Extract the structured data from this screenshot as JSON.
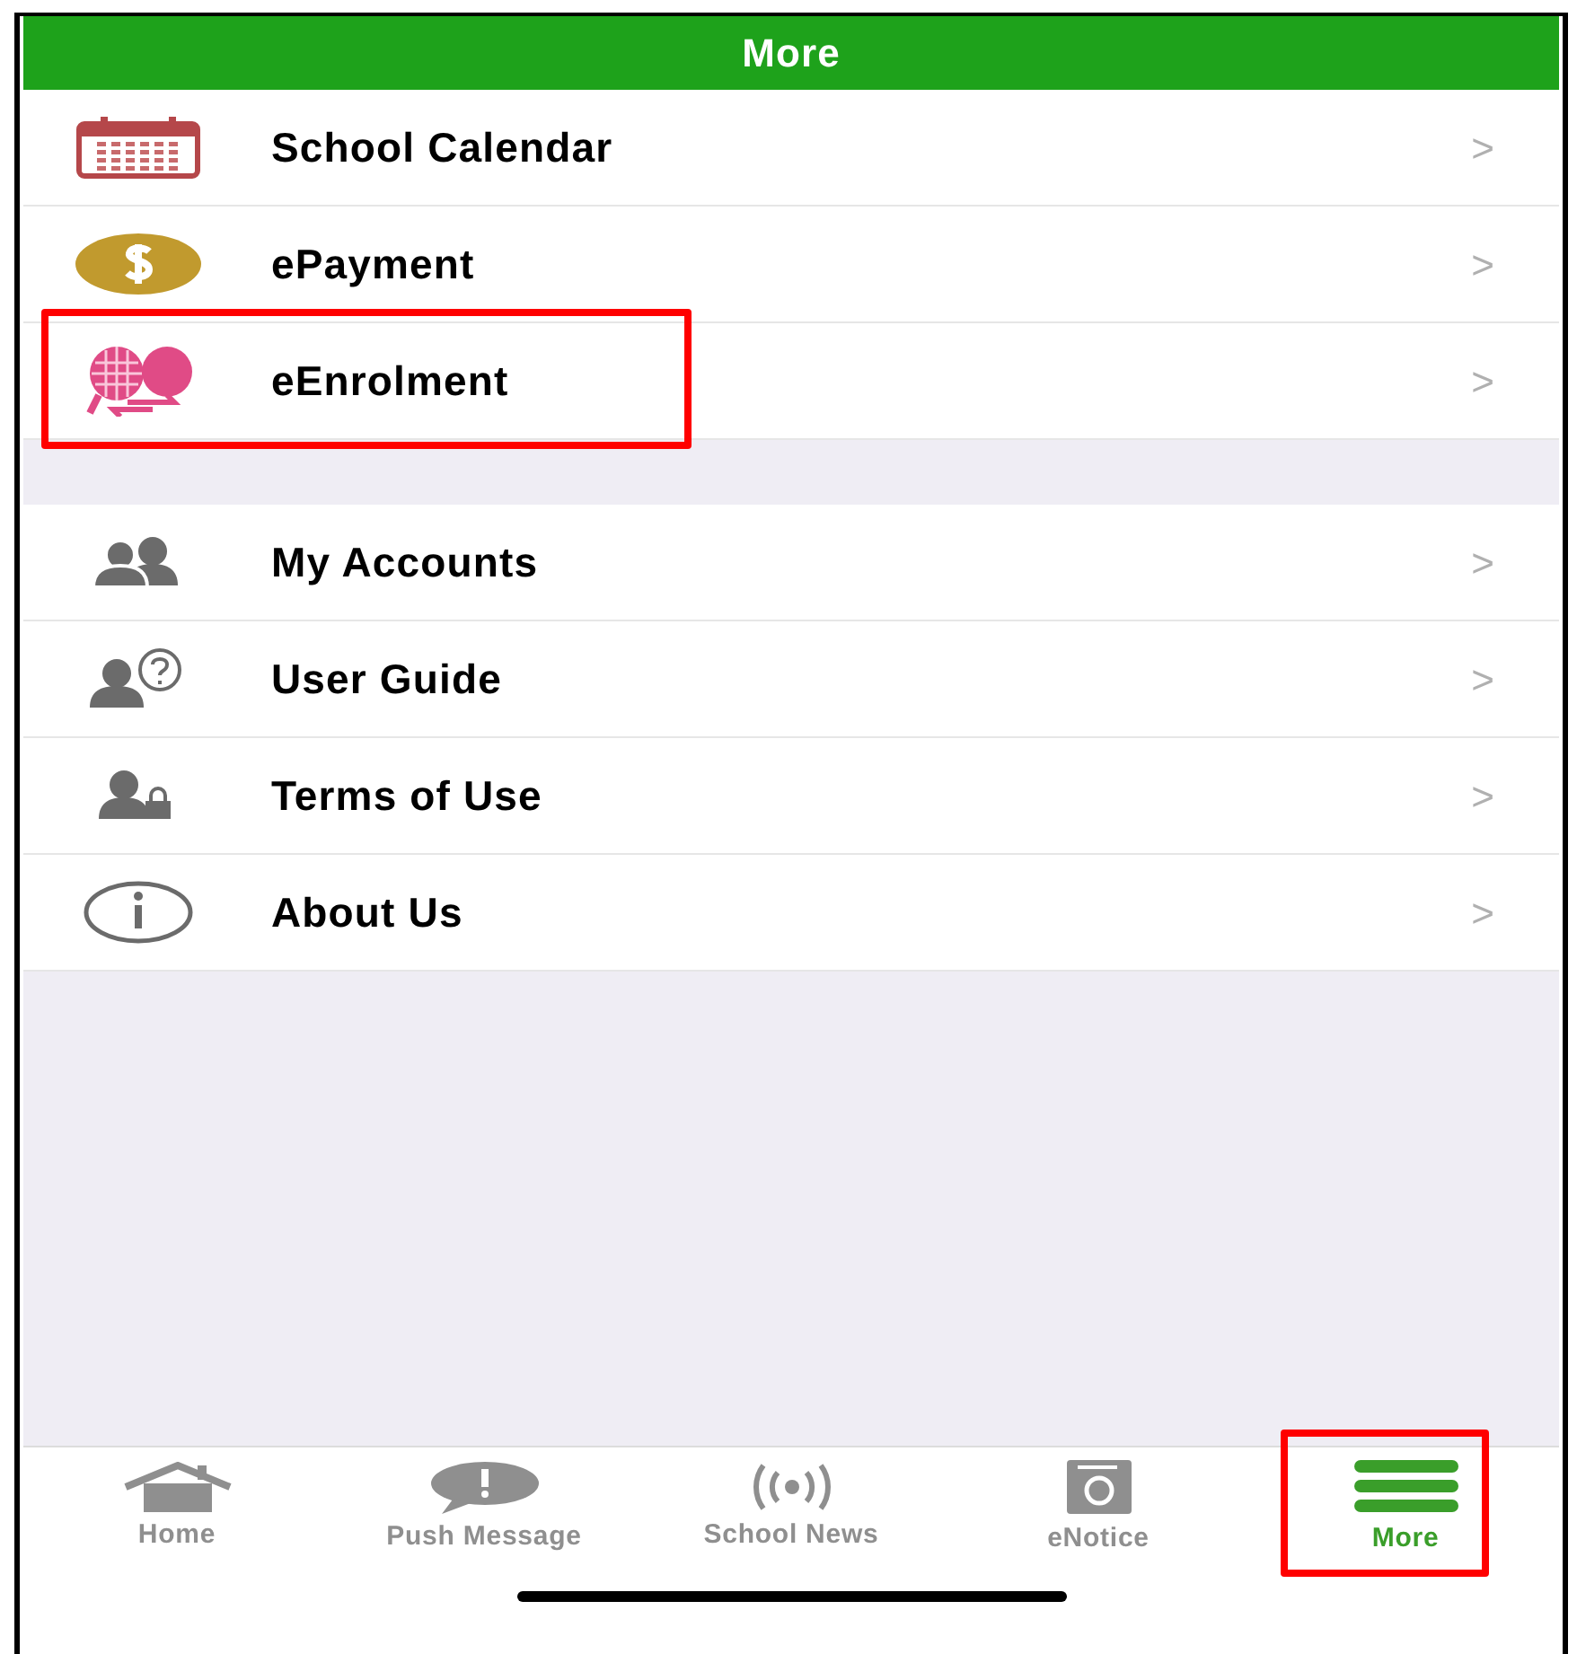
{
  "header": {
    "title": "More"
  },
  "groups": [
    {
      "items": [
        {
          "label": "School Calendar",
          "chevron": ">",
          "highlighted": false
        },
        {
          "label": "ePayment",
          "chevron": ">",
          "highlighted": false
        },
        {
          "label": "eEnrolment",
          "chevron": ">",
          "highlighted": true
        }
      ]
    },
    {
      "items": [
        {
          "label": "My Accounts",
          "chevron": ">",
          "highlighted": false
        },
        {
          "label": "User Guide",
          "chevron": ">",
          "highlighted": false
        },
        {
          "label": "Terms of Use",
          "chevron": ">",
          "highlighted": false
        },
        {
          "label": "About Us",
          "chevron": ">",
          "highlighted": false
        }
      ]
    }
  ],
  "tab_bar": [
    {
      "label": "Home",
      "selected": false,
      "highlighted": false
    },
    {
      "label": "Push Message",
      "selected": false,
      "highlighted": false
    },
    {
      "label": "School News",
      "selected": false,
      "highlighted": false
    },
    {
      "label": "eNotice",
      "selected": false,
      "highlighted": false
    },
    {
      "label": "More",
      "selected": true,
      "highlighted": true
    }
  ]
}
